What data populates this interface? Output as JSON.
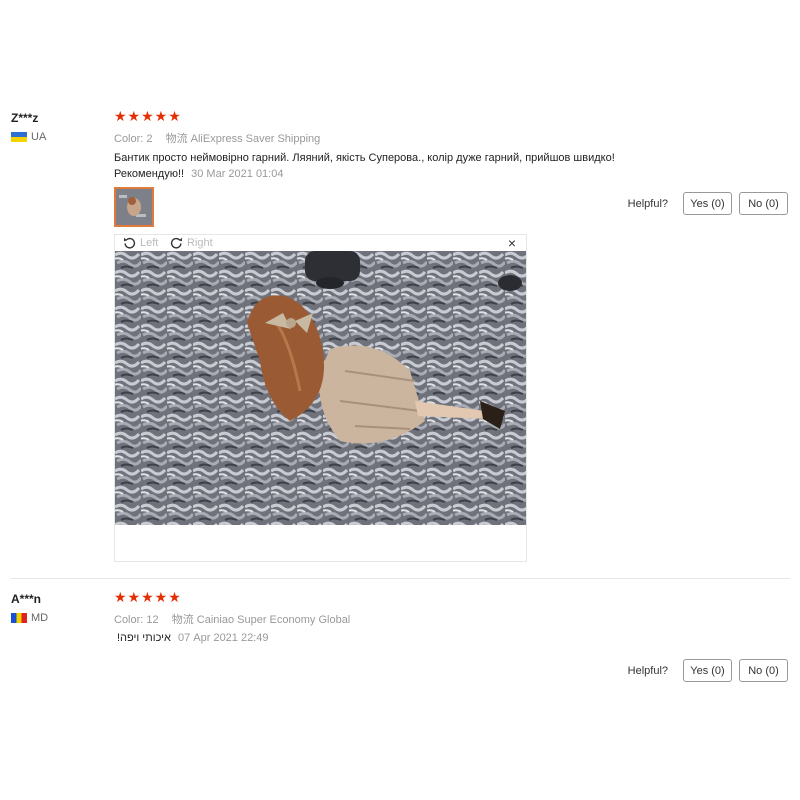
{
  "reviews": [
    {
      "user": "Z***z",
      "country": "UA",
      "stars": "★★★★★",
      "color_label": "Color:",
      "color_value": "2",
      "shipping_label": "物流",
      "shipping_value": "AliExpress Saver Shipping",
      "text": "Бантик просто неймовірно гарний. Ляяний, якість Суперова., колір дуже гарний, прийшов швидко! Рекомендую!!",
      "date": "30 Mar 2021 01:04",
      "helpful_label": "Helpful?",
      "yes_label": "Yes (0)",
      "no_label": "No (0)",
      "viewer": {
        "left_label": "Left",
        "right_label": "Right",
        "close": "×"
      }
    },
    {
      "user": "A***n",
      "country": "MD",
      "stars": "★★★★★",
      "color_label": "Color:",
      "color_value": "12",
      "shipping_label": "物流",
      "shipping_value": "Cainiao Super Economy Global",
      "text": "איכותי ויפה!",
      "date": "07 Apr 2021 22:49",
      "helpful_label": "Helpful?",
      "yes_label": "Yes (0)",
      "no_label": "No (0)"
    }
  ],
  "colors": {
    "star": "#e62e04",
    "thumb_border": "#e07a3a"
  }
}
